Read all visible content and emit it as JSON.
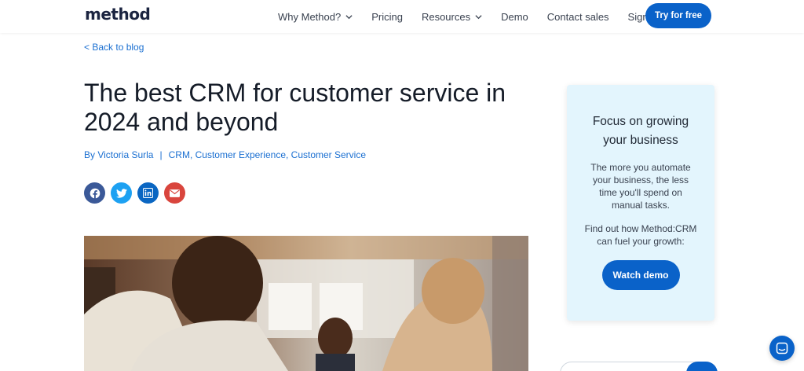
{
  "header": {
    "logo": "method",
    "nav": [
      {
        "label": "Why Method?",
        "dropdown": true
      },
      {
        "label": "Pricing",
        "dropdown": false
      },
      {
        "label": "Resources",
        "dropdown": true
      },
      {
        "label": "Demo",
        "dropdown": false
      },
      {
        "label": "Contact sales",
        "dropdown": false
      },
      {
        "label": "Sign in",
        "dropdown": false
      }
    ],
    "cta": "Try for free"
  },
  "article": {
    "back_link": "< Back to blog",
    "title": "The best CRM for customer service in 2024 and beyond",
    "author": "By Victoria Surla",
    "separator": "|",
    "categories": "CRM, Customer Experience, Customer Service",
    "share_icons": [
      "facebook-icon",
      "twitter-icon",
      "linkedin-icon",
      "email-icon"
    ]
  },
  "sidebar": {
    "heading": "Focus on growing your business",
    "body": "The more you automate your business, the less time you'll spend on manual tasks.",
    "find": "Find out how Method:CRM can fuel your growth:",
    "button": "Watch demo"
  },
  "colors": {
    "brand_blue": "#0a62c9",
    "link_blue": "#1a6fd1",
    "card_bg": "#e3f5fd"
  }
}
